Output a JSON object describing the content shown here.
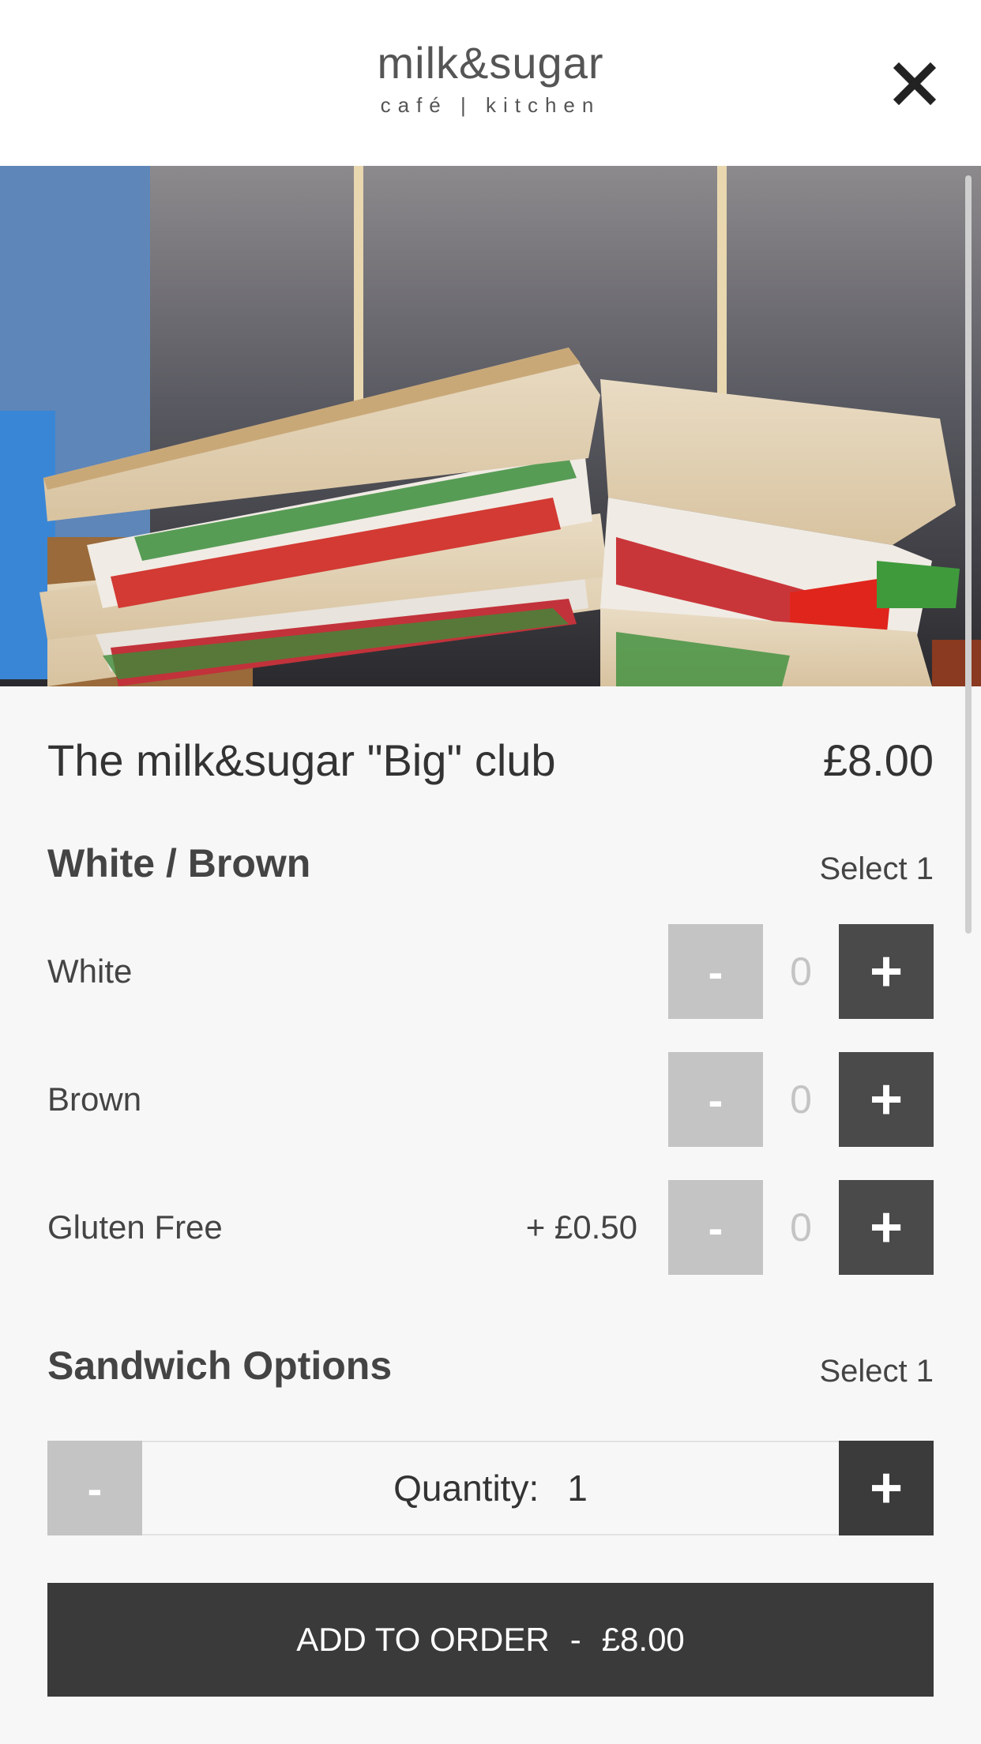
{
  "header": {
    "logo_main": "milk&sugar",
    "logo_sub": "café | kitchen",
    "close_icon": "close-icon"
  },
  "hero": {
    "image": "club-sandwich-photo"
  },
  "item": {
    "title": "The milk&sugar \"Big\" club",
    "price": "£8.00"
  },
  "groups": [
    {
      "title": "White / Brown",
      "select": "Select 1",
      "options": [
        {
          "label": "White",
          "extra": "",
          "count": "0",
          "minus": "-",
          "plus": "+"
        },
        {
          "label": "Brown",
          "extra": "",
          "count": "0",
          "minus": "-",
          "plus": "+"
        },
        {
          "label": "Gluten Free",
          "extra": "+ £0.50",
          "count": "0",
          "minus": "-",
          "plus": "+"
        }
      ]
    },
    {
      "title": "Sandwich Options",
      "select": "Select 1",
      "options": []
    }
  ],
  "quantity": {
    "label": "Quantity:",
    "value": "1",
    "minus": "-",
    "plus": "+"
  },
  "add_button": {
    "label": "ADD TO ORDER",
    "separator": "-",
    "total": "£8.00"
  },
  "colors": {
    "page_bg": "#f7f7f7",
    "dark_button": "#4a4a4a",
    "disabled_button": "#c4c4c4",
    "add_button": "#3a3a3a"
  }
}
